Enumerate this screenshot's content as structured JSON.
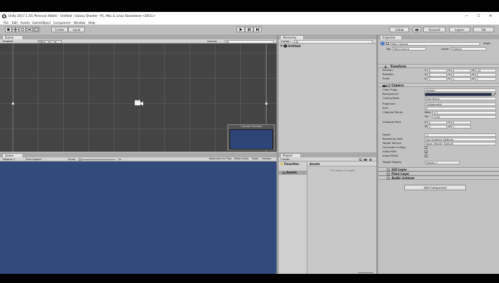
{
  "window": {
    "title": "Unity 2017.1.1f1 Personal (64bit) - Untitled - Galaxy Shooter - PC, Mac & Linux Standalone <DX11>",
    "controls": [
      "—",
      "☐",
      "✕"
    ]
  },
  "menu": [
    "File",
    "Edit",
    "Assets",
    "GameObject",
    "Component",
    "Window",
    "Help"
  ],
  "toolbar": {
    "pivot": "Center",
    "space": "Local",
    "collab": "Collab",
    "account": "Account",
    "layers": "Layers",
    "layout": "Tall"
  },
  "scene": {
    "tab": "Scene",
    "shading": "Shaded",
    "mode_2d": "2D",
    "gizmos": "Gizmos",
    "search": "All",
    "camera_preview": "Camera Preview"
  },
  "game": {
    "tab": "Game",
    "display": "Display 1",
    "aspect": "Free Aspect",
    "scale_label": "Scale",
    "scale_value": "1x",
    "maximize": "Maximize On Play",
    "mute": "Mute Audio",
    "stats": "Stats",
    "gizmos": "Gizmos"
  },
  "hierarchy": {
    "tab": "Hierarchy",
    "create": "Create",
    "search": "All",
    "scene_name": "Untitled"
  },
  "project": {
    "tab": "Project",
    "create": "Create",
    "favorites": "Favorites",
    "assets_header": "Assets",
    "tree_assets": "Assets",
    "empty": "This folder is empty"
  },
  "inspector": {
    "tab": "Inspector",
    "object_name": "Main Camera",
    "static": "Static",
    "tag_label": "Tag",
    "tag_value": "MainCamera",
    "layer_label": "Layer",
    "layer_value": "Default",
    "transform": {
      "title": "Transform",
      "rows": [
        {
          "label": "Position",
          "x": "0",
          "y": "0",
          "z": "-10"
        },
        {
          "label": "Rotation",
          "x": "0",
          "y": "0",
          "z": "0"
        },
        {
          "label": "Scale",
          "x": "1",
          "y": "1",
          "z": "1"
        }
      ]
    },
    "camera": {
      "title": "Camera",
      "clear_flags_label": "Clear Flags",
      "clear_flags_value": "Skybox",
      "background_label": "Background",
      "background_color": "#1d2a4e",
      "culling_label": "Culling Mask",
      "culling_value": "Everything",
      "projection_label": "Projection",
      "projection_value": "Orthographic",
      "size_label": "Size",
      "size_value": "5",
      "clipping_label": "Clipping Planes",
      "near_label": "Near",
      "near_value": "0.3",
      "far_label": "Far",
      "far_value": "1000",
      "viewport_label": "Viewport Rect",
      "vx_label": "X",
      "vx": "0",
      "vy_label": "Y",
      "vy": "0",
      "vw_label": "W",
      "vw": "1",
      "vh_label": "H",
      "vh": "1",
      "depth_label": "Depth",
      "depth_value": "-1",
      "render_path_label": "Rendering Path",
      "render_path_value": "Use Graphics Settings",
      "target_texture_label": "Target Texture",
      "target_texture_value": "None (Render Texture)",
      "occlusion_label": "Occlusion Culling",
      "hdr_label": "Allow HDR",
      "msaa_label": "Allow MSAA",
      "target_display_label": "Target Display",
      "target_display_value": "Display 1"
    },
    "components": [
      "GUI Layer",
      "Flare Layer",
      "Audio Listener"
    ],
    "add_component": "Add Component"
  },
  "colors": {
    "game_bg": "#334a7c",
    "scene_bg": "#444444",
    "preview_bg": "#2f4577",
    "accent_blue": "#3b72c4"
  }
}
